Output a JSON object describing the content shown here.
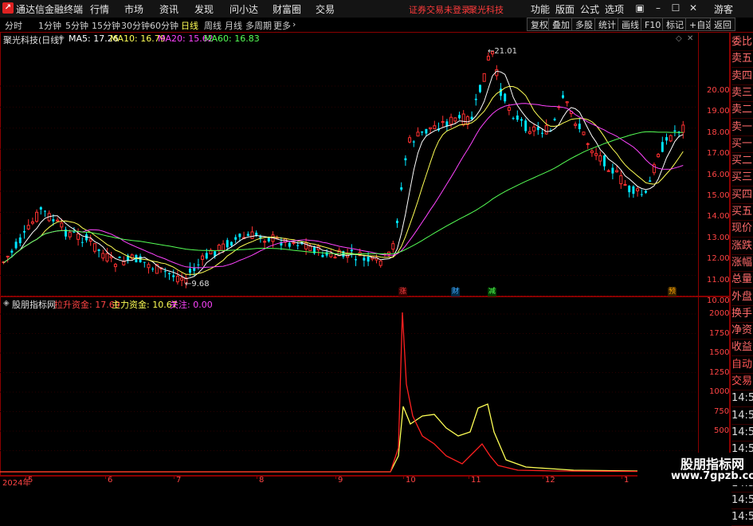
{
  "window": {
    "app_title": "通达信金融终端",
    "menu": [
      "行情",
      "市场",
      "资讯",
      "发现",
      "问小达",
      "财富圈",
      "交易"
    ],
    "trade_status": "证券交易未登录",
    "stock_link": "聚光科技",
    "right_menu": [
      "功能",
      "版面",
      "公式",
      "选项"
    ],
    "user": "游客"
  },
  "toolbar": {
    "periods": [
      "分时",
      "1分钟",
      "5分钟",
      "15分钟",
      "30分钟",
      "60分钟",
      "日线",
      "周线",
      "月线",
      "多周期",
      "更多"
    ],
    "active_period": "日线",
    "buttons": [
      "复权",
      "叠加",
      "多股",
      "统计",
      "画线",
      "F10",
      "标记",
      "+自选",
      "返回"
    ]
  },
  "price_chart": {
    "stock_name": "聚光科技(日线)",
    "ma": [
      {
        "label": "MA5: 17.26",
        "color": "#ffffff"
      },
      {
        "label": "MA10: 16.79",
        "color": "#ffff55"
      },
      {
        "label": "MA20: 15.62",
        "color": "#ff44ff"
      },
      {
        "label": "MA60: 16.83",
        "color": "#55ff55"
      }
    ],
    "y_ticks": [
      "20.00",
      "19.00",
      "18.00",
      "17.00",
      "16.00",
      "15.00",
      "14.00",
      "13.00",
      "12.00",
      "11.00",
      "10.00"
    ],
    "high_label": "21.01",
    "low_label": "9.68",
    "event_marks": [
      {
        "text": "涨",
        "color": "#ff4444"
      },
      {
        "text": "财",
        "color": "#44aaff"
      },
      {
        "text": "减",
        "color": "#55ff55"
      },
      {
        "text": "预",
        "color": "#ffaa00"
      }
    ]
  },
  "side_panel": [
    "委比",
    "卖五",
    "卖四",
    "卖三",
    "卖二",
    "卖一",
    "买一",
    "买二",
    "买三",
    "买四",
    "买五",
    "现价",
    "涨跌",
    "涨幅",
    "总量",
    "外盘",
    "换手",
    "净资",
    "收益",
    "自动",
    "交易",
    "14:56",
    "14:56",
    "14:56",
    "14:56",
    "14:56",
    "14:56",
    "14:56",
    "14:56"
  ],
  "indicator": {
    "name": "股朋指标网",
    "items": [
      {
        "label": "拉升资金: 17.69",
        "color": "#ff4444"
      },
      {
        "label": "主力资金: 10.67",
        "color": "#ffff55"
      },
      {
        "label": "关注: 0.00",
        "color": "#ff44ff"
      }
    ],
    "y_ticks": [
      "2000",
      "1750",
      "1500",
      "1250",
      "1000",
      "750",
      "500"
    ]
  },
  "x_axis": {
    "labels": [
      "2024年",
      "5",
      "6",
      "7",
      "8",
      "9",
      "10",
      "11",
      "12",
      "1"
    ]
  },
  "watermark": {
    "line1": "股朋指标网",
    "line2": "www.7gpzb.com"
  }
}
